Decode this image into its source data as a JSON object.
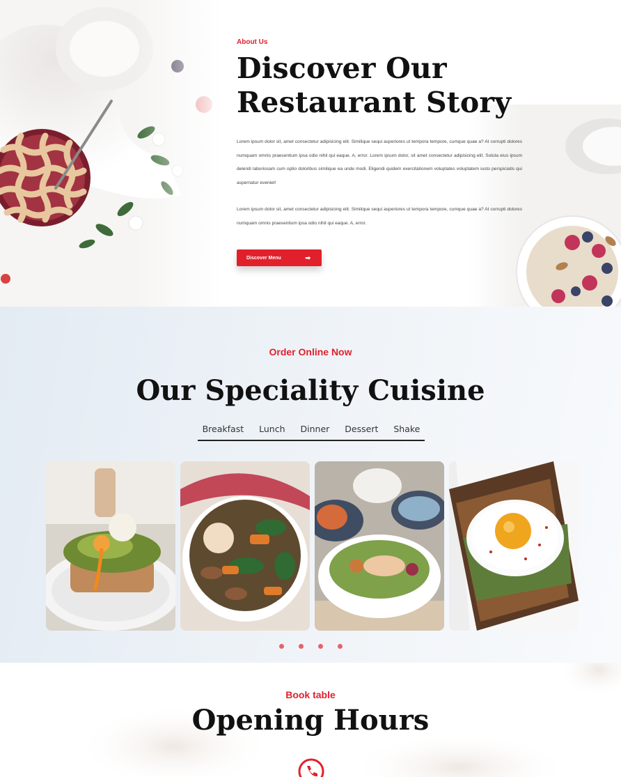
{
  "about": {
    "eyebrow": "About Us",
    "title_line1": "Discover Our",
    "title_line2": "Restaurant Story",
    "paragraph1": "Lorem ipsum dolor sit, amet consectetur adipisicing elit. Similique sequi asperiores ut tempora tempore, cumque quae a? At corrupti dolores numquam omnis praesentium ipsa odio nihil qui eaque. A, error. Lorem ipsum dolor, sit amet consectetur adipisicing elit. Soluta eius ipsum deleniti laboriosam cum optio doloribus similique ea unde modi. Eligendi quidem exercitationem voluptates voluptatem iusto perspiciatis qui aspernatur eveniet!",
    "paragraph2": "Lorem ipsum dolor sit, amet consectetur adipisicing elit. Similique sequi asperiores ut tempora tempore, cumque quae a? At corrupti dolores numquam omnis praesentium ipsa odio nihil qui eaque. A, error.",
    "button_label": "Discover Menu",
    "button_icon": "arrow-right-icon"
  },
  "speciality": {
    "eyebrow": "Order Online Now",
    "title": "Our Speciality Cuisine",
    "tabs": [
      "Breakfast",
      "Lunch",
      "Dinner",
      "Dessert",
      "Shake"
    ],
    "cards": [
      {
        "image": "avocado-toast-egg-photo"
      },
      {
        "image": "roasted-vegetable-bowl-photo"
      },
      {
        "image": "salad-bowl-photo"
      },
      {
        "image": "fried-egg-toast-photo"
      }
    ],
    "dot_count": 4
  },
  "hours": {
    "eyebrow": "Book table",
    "title": "Opening Hours",
    "icon": "phone-icon"
  },
  "colors": {
    "accent": "#e1202c",
    "heading": "#111111",
    "section_bg": "#e8eef4"
  }
}
